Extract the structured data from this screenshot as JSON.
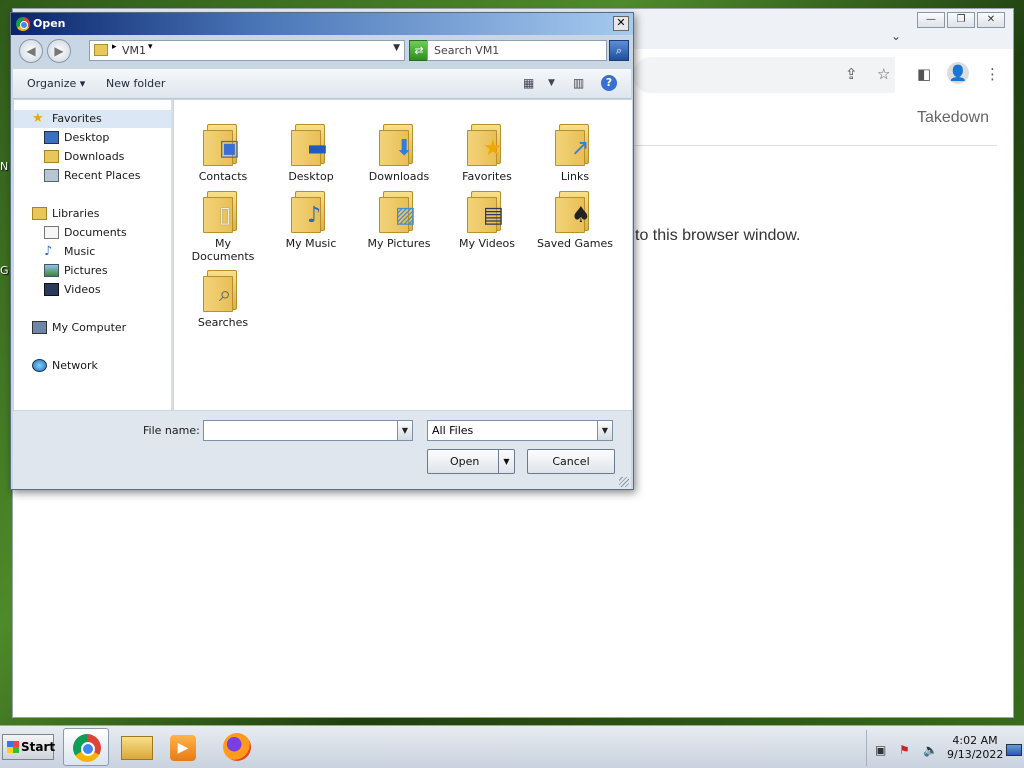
{
  "desktop": {
    "fragment_1": "N",
    "fragment_2": "G"
  },
  "browser": {
    "takedown_label": "Takedown",
    "page_message": "to this browser window."
  },
  "dialog": {
    "title": "Open",
    "close_glyph": "✕",
    "address": {
      "crumb": "VM1"
    },
    "search": {
      "placeholder": "Search VM1"
    },
    "toolbar": {
      "organize": "Organize",
      "new_folder": "New folder"
    },
    "nav": {
      "favorites": "Favorites",
      "desktop": "Desktop",
      "downloads": "Downloads",
      "recent_places": "Recent Places",
      "libraries": "Libraries",
      "documents": "Documents",
      "music": "Music",
      "pictures": "Pictures",
      "videos": "Videos",
      "my_computer": "My Computer",
      "network": "Network"
    },
    "folders": {
      "contacts": "Contacts",
      "desktop": "Desktop",
      "downloads": "Downloads",
      "favorites": "Favorites",
      "links": "Links",
      "my_documents": "My Documents",
      "my_music": "My Music",
      "my_pictures": "My Pictures",
      "my_videos": "My Videos",
      "saved_games": "Saved Games",
      "searches": "Searches"
    },
    "file_name_label": "File name:",
    "file_name_value": "",
    "file_type": "All Files",
    "open_button": "Open",
    "cancel_button": "Cancel"
  },
  "taskbar": {
    "start_label": "Start",
    "clock_time": "4:02 AM",
    "clock_date": "9/13/2022"
  },
  "colors": {
    "title_gradient_start": "#0a246a",
    "title_gradient_end": "#a6caf0",
    "selected_nav": "#dce7f5",
    "folder_yellow": "#f3d37a"
  }
}
